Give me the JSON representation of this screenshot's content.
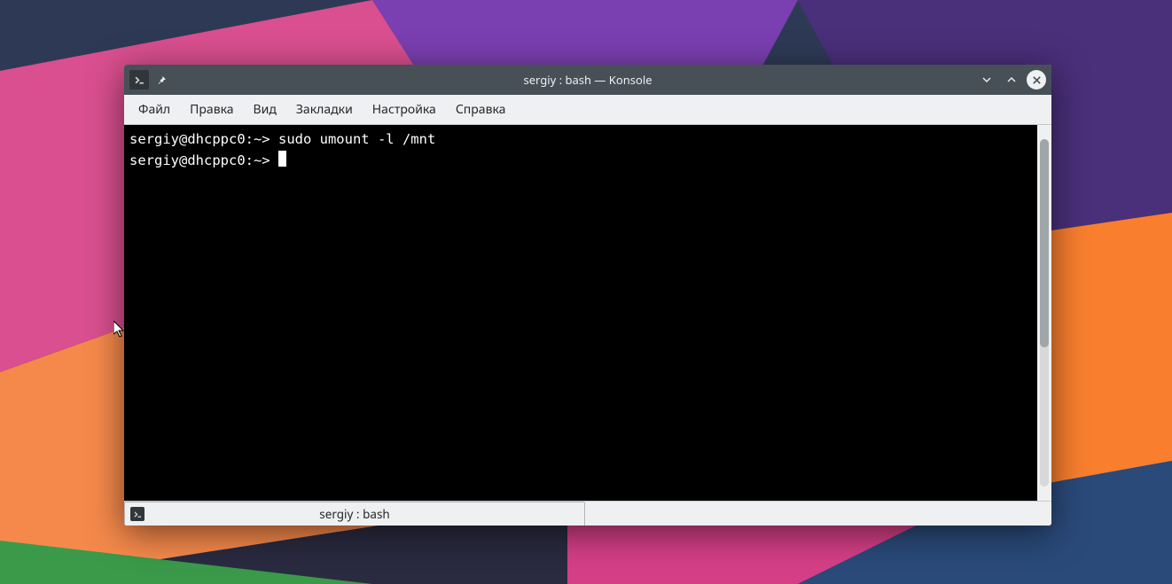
{
  "window": {
    "title": "sergiy : bash — Konsole"
  },
  "menubar": {
    "items": [
      "Файл",
      "Правка",
      "Вид",
      "Закладки",
      "Настройка",
      "Справка"
    ]
  },
  "terminal": {
    "lines": [
      {
        "prompt": "sergiy@dhcppc0:~>",
        "command": "sudo umount -l /mnt"
      },
      {
        "prompt": "sergiy@dhcppc0:~>",
        "command": "",
        "cursor": true
      }
    ]
  },
  "tabs": [
    {
      "label": "sergiy : bash"
    }
  ]
}
